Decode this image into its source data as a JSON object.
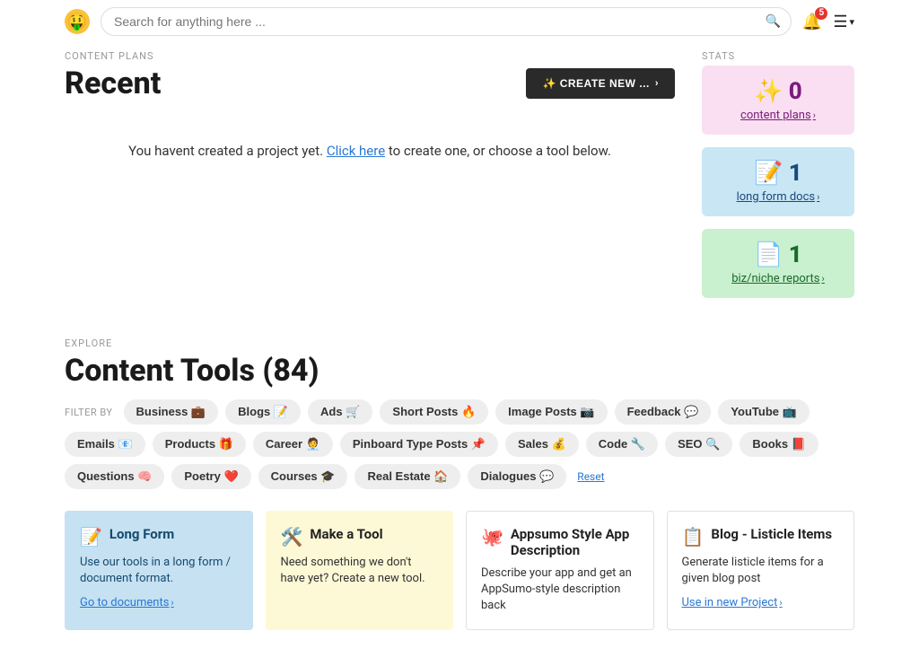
{
  "header": {
    "search_placeholder": "Search for anything here ...",
    "notification_count": "5"
  },
  "content_plans": {
    "label": "CONTENT PLANS",
    "title": "Recent",
    "create_button": "✨ CREATE NEW ...",
    "empty_pre": "You havent created a project yet. ",
    "empty_link": "Click here",
    "empty_post": " to create one, or choose a tool below."
  },
  "stats": {
    "label": "STATS",
    "cards": [
      {
        "icon": "✨",
        "value": "0",
        "link": "content plans"
      },
      {
        "icon": "📝",
        "value": "1",
        "link": "long form docs"
      },
      {
        "icon": "📄",
        "value": "1",
        "link": "biz/niche reports"
      }
    ]
  },
  "explore": {
    "label": "EXPLORE",
    "title": "Content Tools (84)",
    "filter_label": "FILTER BY",
    "filters": [
      "Business 💼",
      "Blogs 📝",
      "Ads 🛒",
      "Short Posts 🔥",
      "Image Posts 📷",
      "Feedback 💬",
      "YouTube 📺",
      "Emails 📧",
      "Products 🎁",
      "Career 🧑‍💼",
      "Pinboard Type Posts 📌",
      "Sales 💰",
      "Code 🔧",
      "SEO 🔍",
      "Books 📕",
      "Questions 🧠",
      "Poetry ❤️",
      "Courses 🎓",
      "Real Estate 🏠",
      "Dialogues 💬"
    ],
    "reset": "Reset"
  },
  "cards": [
    {
      "icon": "📝",
      "title": "Long Form",
      "desc": "Use our tools in a long form / document format.",
      "link": "Go to documents"
    },
    {
      "icon": "🛠️",
      "title": "Make a Tool",
      "desc": "Need something we don't have yet? Create a new tool.",
      "link": ""
    },
    {
      "icon": "🐙",
      "title": "Appsumo Style App Description",
      "desc": "Describe your app and get an AppSumo-style description back",
      "link": ""
    },
    {
      "icon": "📋",
      "title": "Blog - Listicle Items",
      "desc": "Generate listicle items for a given blog post",
      "link": "Use in new Project"
    }
  ]
}
